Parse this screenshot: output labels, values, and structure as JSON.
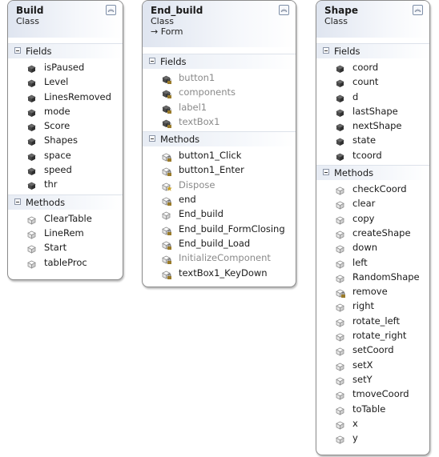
{
  "classes": [
    {
      "name": "Build",
      "kind": "Class",
      "base": "",
      "sections": [
        {
          "title": "Fields",
          "members": [
            {
              "name": "isPaused",
              "type": "field"
            },
            {
              "name": "Level",
              "type": "field"
            },
            {
              "name": "LinesRemoved",
              "type": "field"
            },
            {
              "name": "mode",
              "type": "field"
            },
            {
              "name": "Score",
              "type": "field"
            },
            {
              "name": "Shapes",
              "type": "field"
            },
            {
              "name": "space",
              "type": "field"
            },
            {
              "name": "speed",
              "type": "field"
            },
            {
              "name": "thr",
              "type": "field"
            }
          ]
        },
        {
          "title": "Methods",
          "members": [
            {
              "name": "ClearTable",
              "type": "method"
            },
            {
              "name": "LineRem",
              "type": "method"
            },
            {
              "name": "Start",
              "type": "method"
            },
            {
              "name": "tableProc",
              "type": "method"
            }
          ]
        }
      ]
    },
    {
      "name": "End_build",
      "kind": "Class",
      "base": "→ Form",
      "sections": [
        {
          "title": "Fields",
          "members": [
            {
              "name": "button1",
              "type": "private-field",
              "gray": true
            },
            {
              "name": "components",
              "type": "private-field",
              "gray": true
            },
            {
              "name": "label1",
              "type": "private-field",
              "gray": true
            },
            {
              "name": "textBox1",
              "type": "private-field",
              "gray": true
            }
          ]
        },
        {
          "title": "Methods",
          "members": [
            {
              "name": "button1_Click",
              "type": "private-method"
            },
            {
              "name": "button1_Enter",
              "type": "private-method"
            },
            {
              "name": "Dispose",
              "type": "protected-method",
              "gray": true
            },
            {
              "name": "end",
              "type": "private-method"
            },
            {
              "name": "End_build",
              "type": "method"
            },
            {
              "name": "End_build_FormClosing",
              "type": "private-method"
            },
            {
              "name": "End_build_Load",
              "type": "private-method"
            },
            {
              "name": "InitializeComponent",
              "type": "private-method",
              "gray": true
            },
            {
              "name": "textBox1_KeyDown",
              "type": "private-method"
            }
          ]
        }
      ]
    },
    {
      "name": "Shape",
      "kind": "Class",
      "base": "",
      "sections": [
        {
          "title": "Fields",
          "members": [
            {
              "name": "coord",
              "type": "field"
            },
            {
              "name": "count",
              "type": "field"
            },
            {
              "name": "d",
              "type": "field"
            },
            {
              "name": "lastShape",
              "type": "field"
            },
            {
              "name": "nextShape",
              "type": "field"
            },
            {
              "name": "state",
              "type": "field"
            },
            {
              "name": "tcoord",
              "type": "field"
            }
          ]
        },
        {
          "title": "Methods",
          "members": [
            {
              "name": "checkCoord",
              "type": "method"
            },
            {
              "name": "clear",
              "type": "method"
            },
            {
              "name": "copy",
              "type": "method"
            },
            {
              "name": "createShape",
              "type": "method"
            },
            {
              "name": "down",
              "type": "method"
            },
            {
              "name": "left",
              "type": "method"
            },
            {
              "name": "RandomShape",
              "type": "method"
            },
            {
              "name": "remove",
              "type": "private-method"
            },
            {
              "name": "right",
              "type": "method"
            },
            {
              "name": "rotate_left",
              "type": "method"
            },
            {
              "name": "rotate_right",
              "type": "method"
            },
            {
              "name": "setCoord",
              "type": "method"
            },
            {
              "name": "setX",
              "type": "method"
            },
            {
              "name": "setY",
              "type": "method"
            },
            {
              "name": "tmoveCoord",
              "type": "method"
            },
            {
              "name": "toTable",
              "type": "method"
            },
            {
              "name": "x",
              "type": "method"
            },
            {
              "name": "y",
              "type": "method"
            }
          ]
        }
      ]
    }
  ],
  "icons": {
    "collapse": "double-chevron-up-icon",
    "section_toggle": "minus-box-icon",
    "field": "field-icon",
    "method": "method-icon"
  },
  "colors": {
    "header_gradient": "#dfe5f0",
    "member_gray": "#8a8a8a",
    "method_icon": "#8e8e8e",
    "field_icon": "#4a4a4a",
    "lock_icon": "#9a7b2a"
  }
}
